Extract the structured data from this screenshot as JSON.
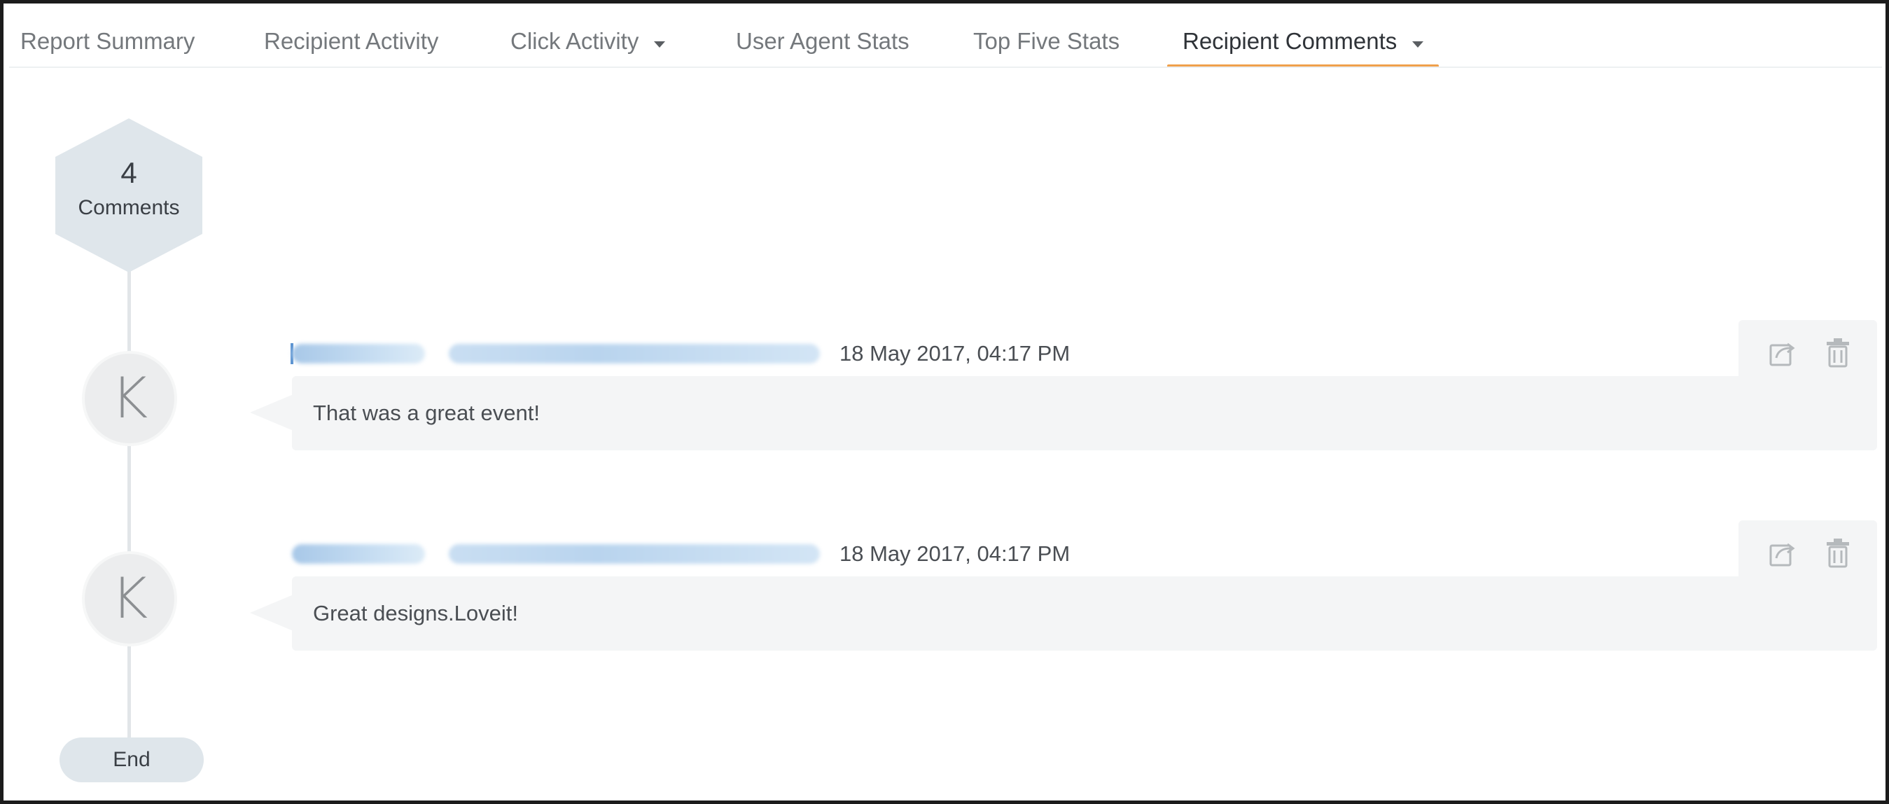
{
  "tabs": [
    {
      "label": "Report Summary",
      "has_dropdown": false,
      "active": false
    },
    {
      "label": "Recipient Activity",
      "has_dropdown": false,
      "active": false
    },
    {
      "label": "Click Activity",
      "has_dropdown": true,
      "active": false
    },
    {
      "label": "User Agent Stats",
      "has_dropdown": false,
      "active": false
    },
    {
      "label": "Top Five Stats",
      "has_dropdown": false,
      "active": false
    },
    {
      "label": "Recipient Comments",
      "has_dropdown": true,
      "active": true
    }
  ],
  "summary": {
    "count": "4",
    "label": "Comments"
  },
  "comments": [
    {
      "avatar_letter": "K",
      "date": "18 May 2017, 04:17 PM",
      "text": "That was a great event!"
    },
    {
      "avatar_letter": "K",
      "date": "18 May 2017, 04:17 PM",
      "text": "Great designs.Loveit!"
    }
  ],
  "end_label": "End",
  "colors": {
    "accent": "#f0a04b",
    "hex_fill": "#dfe6eb",
    "bubble": "#f4f5f6",
    "timeline": "#e1e5e8"
  },
  "icons": [
    "chevron-down-icon",
    "share-icon",
    "trash-icon"
  ]
}
